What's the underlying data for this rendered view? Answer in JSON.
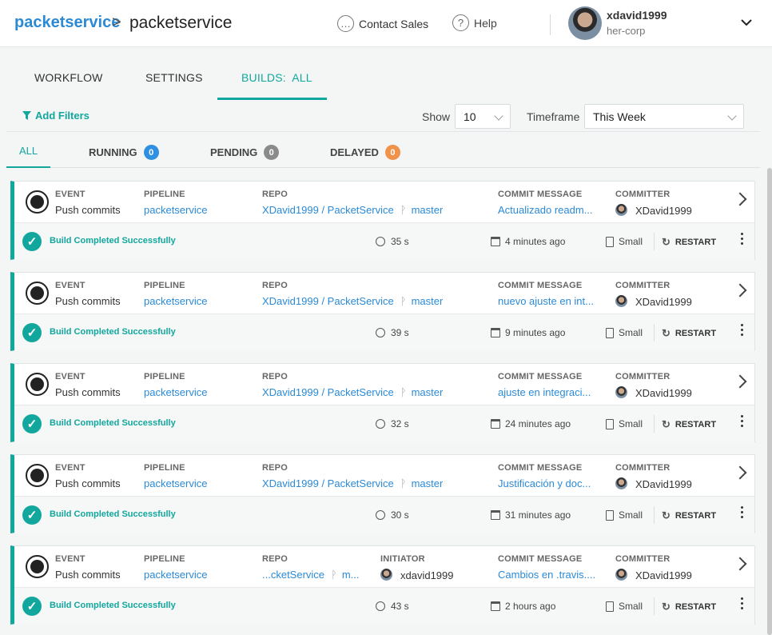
{
  "breadcrumb": {
    "parent": "packetservice",
    "separator": ">",
    "current": "packetservice"
  },
  "header": {
    "contact_label": "Contact Sales",
    "help_label": "Help",
    "username": "xdavid1999",
    "org": "her-corp"
  },
  "tabs": [
    "WORKFLOW",
    "SETTINGS",
    "BUILDS:  ALL"
  ],
  "filters": {
    "add_filters_label": "Add Filters",
    "show_label": "Show",
    "show_value": "10",
    "timeframe_label": "Timeframe",
    "timeframe_value": "This Week"
  },
  "status_tabs": [
    {
      "label": "ALL"
    },
    {
      "label": "RUNNING",
      "count": "0",
      "color": "#2f8fe0"
    },
    {
      "label": "PENDING",
      "count": "0",
      "color": "#8a8a8a"
    },
    {
      "label": "DELAYED",
      "count": "0",
      "color": "#f0924a"
    }
  ],
  "labels": {
    "event": "EVENT",
    "pipeline": "PIPELINE",
    "repo": "REPO",
    "initiator": "INITIATOR",
    "commit_message": "COMMIT MESSAGE",
    "committer": "COMMITTER",
    "restart": "RESTART"
  },
  "accent_color": "#12a79d",
  "builds": [
    {
      "event": "Push commits",
      "pipeline": "packetservice",
      "repo": "XDavid1999 / PacketService",
      "branch": "master",
      "commit": "Actualizado readm...",
      "committer": "XDavid1999",
      "status": "Build Completed Successfully",
      "duration": "35 s",
      "when": "4 minutes ago",
      "size": "Small"
    },
    {
      "event": "Push commits",
      "pipeline": "packetservice",
      "repo": "XDavid1999 / PacketService",
      "branch": "master",
      "commit": "nuevo ajuste en int...",
      "committer": "XDavid1999",
      "status": "Build Completed Successfully",
      "duration": "39 s",
      "when": "9 minutes ago",
      "size": "Small"
    },
    {
      "event": "Push commits",
      "pipeline": "packetservice",
      "repo": "XDavid1999 / PacketService",
      "branch": "master",
      "commit": "ajuste en integraci...",
      "committer": "XDavid1999",
      "status": "Build Completed Successfully",
      "duration": "32 s",
      "when": "24 minutes ago",
      "size": "Small"
    },
    {
      "event": "Push commits",
      "pipeline": "packetservice",
      "repo": "XDavid1999 / PacketService",
      "branch": "master",
      "commit": "Justificación y doc...",
      "committer": "XDavid1999",
      "status": "Build Completed Successfully",
      "duration": "30 s",
      "when": "31 minutes ago",
      "size": "Small"
    },
    {
      "event": "Push commits",
      "pipeline": "packetservice",
      "repo": "...cketService",
      "branch": "m...",
      "initiator": "xdavid1999",
      "commit": "Cambios en .travis....",
      "committer": "XDavid1999",
      "status": "Build Completed Successfully",
      "duration": "43 s",
      "when": "2 hours ago",
      "size": "Small"
    }
  ]
}
